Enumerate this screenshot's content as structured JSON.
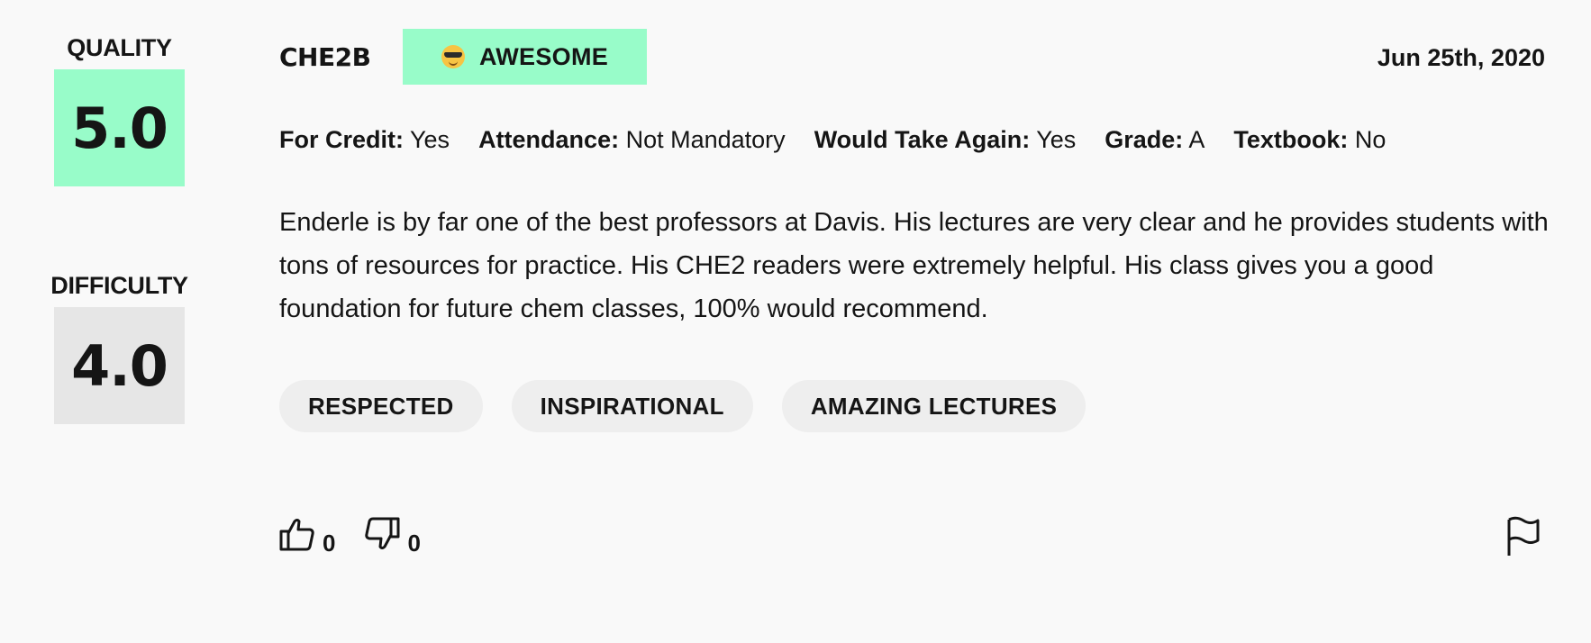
{
  "ratings": {
    "quality_label": "QUALITY",
    "quality_value": "5.0",
    "difficulty_label": "DIFFICULTY",
    "difficulty_value": "4.0"
  },
  "header": {
    "course": "CHE2B",
    "emotion": "AWESOME",
    "emotion_icon": "sunglasses-emoji-icon",
    "date": "Jun 25th, 2020"
  },
  "meta": [
    {
      "label": "For Credit:",
      "value": "Yes"
    },
    {
      "label": "Attendance:",
      "value": "Not Mandatory"
    },
    {
      "label": "Would Take Again:",
      "value": "Yes"
    },
    {
      "label": "Grade:",
      "value": "A"
    },
    {
      "label": "Textbook:",
      "value": "No"
    }
  ],
  "comment": "Enderle is by far one of the best professors at Davis. His lectures are very clear and he provides students with tons of resources for practice. His CHE2 readers were extremely helpful. His class gives you a good foundation for future chem classes, 100% would recommend.",
  "tags": [
    "RESPECTED",
    "INSPIRATIONAL",
    "AMAZING LECTURES"
  ],
  "footer": {
    "thumbs_up_icon": "thumbs-up-icon",
    "thumbs_up_count": "0",
    "thumbs_down_icon": "thumbs-down-icon",
    "thumbs_down_count": "0",
    "flag_icon": "flag-icon"
  },
  "colors": {
    "quality_bg": "#98fcc9",
    "difficulty_bg": "#e6e6e6",
    "emotion_bg": "#98fcc9",
    "tag_bg": "#eeeeee",
    "page_bg": "#f9f9f9"
  }
}
